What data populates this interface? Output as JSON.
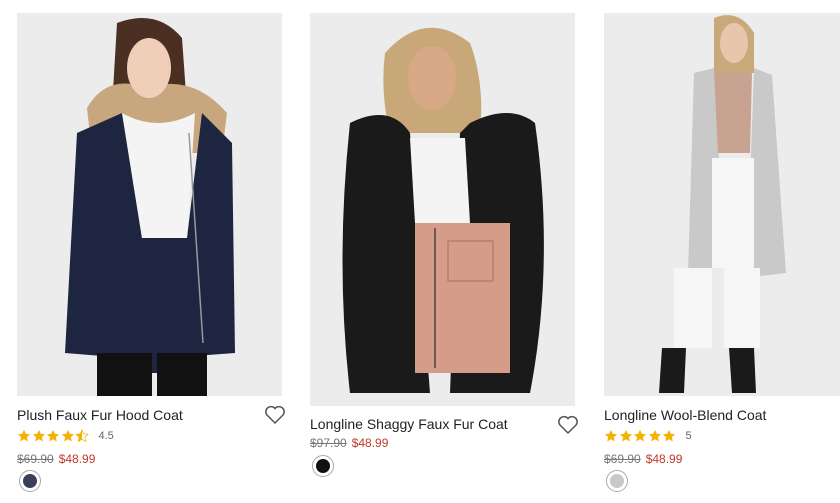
{
  "products": [
    {
      "name": "Plush Faux Fur Hood Coat",
      "rating": {
        "stars": 4.5,
        "label": "4.5"
      },
      "price": {
        "original": "$69.90",
        "sale": "$48.99"
      },
      "swatch_color": "#3a3f5c",
      "coat_color": "#1e2540"
    },
    {
      "name": "Longline Shaggy Faux Fur Coat",
      "price": {
        "original": "$97.90",
        "sale": "$48.99"
      },
      "swatch_color": "#111111",
      "coat_color": "#1a1a1a"
    },
    {
      "name": "Longline Wool-Blend Coat",
      "rating": {
        "stars": 5,
        "label": "5"
      },
      "price": {
        "original": "$69.90",
        "sale": "$48.99"
      },
      "swatch_color": "#c8c8c8",
      "coat_color": "#c9c9c9"
    }
  ],
  "colors": {
    "sale_price": "#c0392b",
    "star": "#f5b301"
  }
}
